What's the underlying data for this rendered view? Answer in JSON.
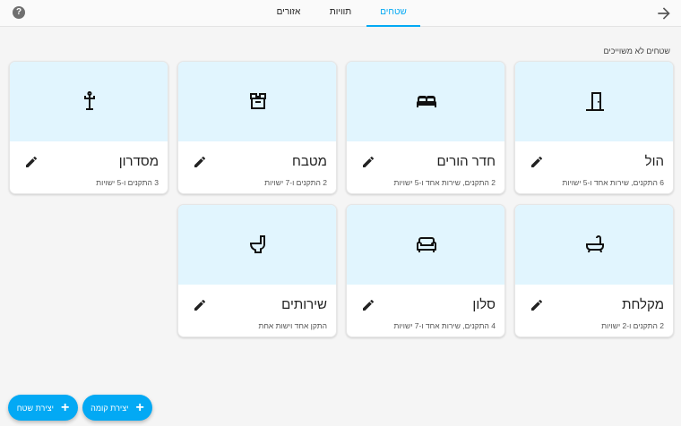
{
  "header": {
    "help_icon_text": "?",
    "tabs": [
      {
        "label": "שטחים",
        "active": true
      },
      {
        "label": "תוויות",
        "active": false
      },
      {
        "label": "אזורים",
        "active": false
      }
    ]
  },
  "section_label": "שטחים לא משוייכים",
  "cards": [
    {
      "title": "הול",
      "description": "6 התקנים, שירות אחד ו-5 ישויות",
      "icon": "door-icon"
    },
    {
      "title": "חדר הורים",
      "description": "2 התקנים, שירות אחד ו-5 ישויות",
      "icon": "bed-icon"
    },
    {
      "title": "מטבח",
      "description": "2 התקנים ו-7 ישויות",
      "icon": "kitchen-icon"
    },
    {
      "title": "מסדרון",
      "description": "3 התקנים ו-5 ישויות",
      "icon": "coat-rack-icon"
    },
    {
      "title": "מקלחת",
      "description": "2 התקנים ו-2 ישויות",
      "icon": "bathtub-icon"
    },
    {
      "title": "סלון",
      "description": "4 התקנים, שירות אחד ו-7 ישויות",
      "icon": "sofa-icon"
    },
    {
      "title": "שירותים",
      "description": "התקן אחד וישות אחת",
      "icon": "toilet-icon"
    }
  ],
  "fabs": {
    "create_floor": "יצירת קומה",
    "create_area": "יצירת שטח"
  },
  "colors": {
    "accent": "#03a9f4",
    "card_header": "#e1f5fe",
    "background": "#f5f5f5"
  }
}
